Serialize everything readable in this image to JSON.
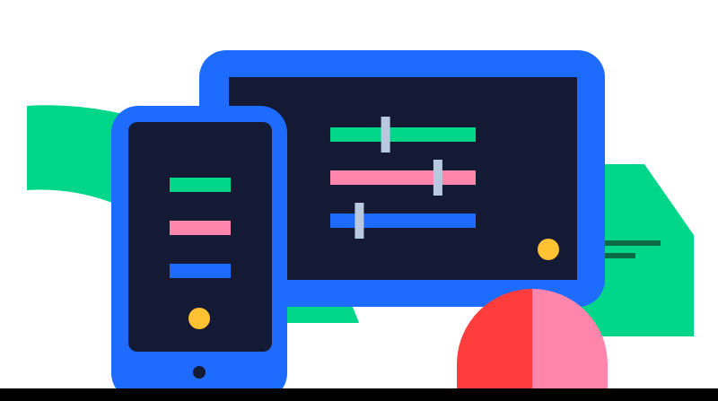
{
  "palette": {
    "background": "#ffffff",
    "device_blue": "#1d6bff",
    "screen_navy": "#141a33",
    "green": "#00d68a",
    "dark_green": "#0a6b45",
    "pink": "#ff85ad",
    "red": "#ff3d3d",
    "yellow": "#ffc233",
    "slider_knob": "#b8c8de",
    "footer_bar": "#000000"
  },
  "tablet": {
    "sliders": [
      {
        "color": "green",
        "level": 0.38
      },
      {
        "color": "pink",
        "level": 0.74
      },
      {
        "color": "blue",
        "level": 0.2
      }
    ],
    "indicator": "yellow-dot"
  },
  "phone": {
    "menu_bars": [
      "green",
      "pink",
      "blue"
    ],
    "indicator": "yellow-dot",
    "home_button": "home-button"
  },
  "decor": {
    "pie_halves": [
      "red",
      "pink"
    ],
    "background_shapes": [
      "green-arc",
      "green-card"
    ]
  }
}
